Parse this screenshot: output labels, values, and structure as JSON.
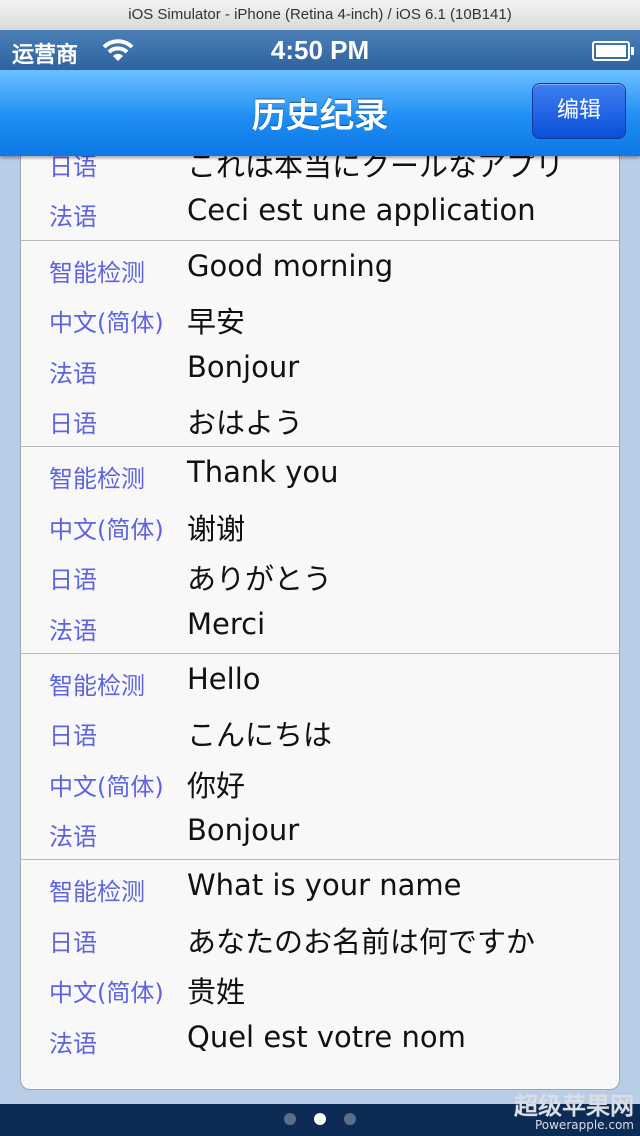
{
  "window_title": "iOS Simulator - iPhone (Retina 4-inch) / iOS 6.1 (10B141)",
  "status_bar": {
    "carrier": "运营商",
    "time": "4:50 PM"
  },
  "navbar": {
    "title": "历史纪录",
    "edit_label": "编辑"
  },
  "groups": [
    {
      "rows": [
        {
          "lang": "日语",
          "text": "これは本当にクールなアプリ"
        },
        {
          "lang": "法语",
          "text": "Ceci est une application"
        }
      ]
    },
    {
      "rows": [
        {
          "lang": "智能检测",
          "text": "Good morning"
        },
        {
          "lang": "中文(简体)",
          "text": "早安"
        },
        {
          "lang": "法语",
          "text": "Bonjour"
        },
        {
          "lang": "日语",
          "text": "おはよう"
        }
      ]
    },
    {
      "rows": [
        {
          "lang": "智能检测",
          "text": "Thank you"
        },
        {
          "lang": "中文(简体)",
          "text": "谢谢"
        },
        {
          "lang": "日语",
          "text": "ありがとう"
        },
        {
          "lang": "法语",
          "text": "Merci"
        }
      ]
    },
    {
      "rows": [
        {
          "lang": "智能检测",
          "text": "Hello"
        },
        {
          "lang": "日语",
          "text": "こんにちは"
        },
        {
          "lang": "中文(简体)",
          "text": "你好"
        },
        {
          "lang": "法语",
          "text": "Bonjour"
        }
      ]
    },
    {
      "rows": [
        {
          "lang": "智能检测",
          "text": "What is your name"
        },
        {
          "lang": "日语",
          "text": "あなたのお名前は何ですか"
        },
        {
          "lang": "中文(简体)",
          "text": "贵姓"
        },
        {
          "lang": "法语",
          "text": "Quel est votre nom"
        }
      ]
    }
  ],
  "page_indicator": {
    "count": 3,
    "active_index": 1
  },
  "watermark": {
    "main": "超级苹果网",
    "sub": "Powerapple.com"
  },
  "colors": {
    "navbar": "#1f8df3",
    "language_label": "#5e64e0",
    "edit_button": "#0a4fd9"
  }
}
